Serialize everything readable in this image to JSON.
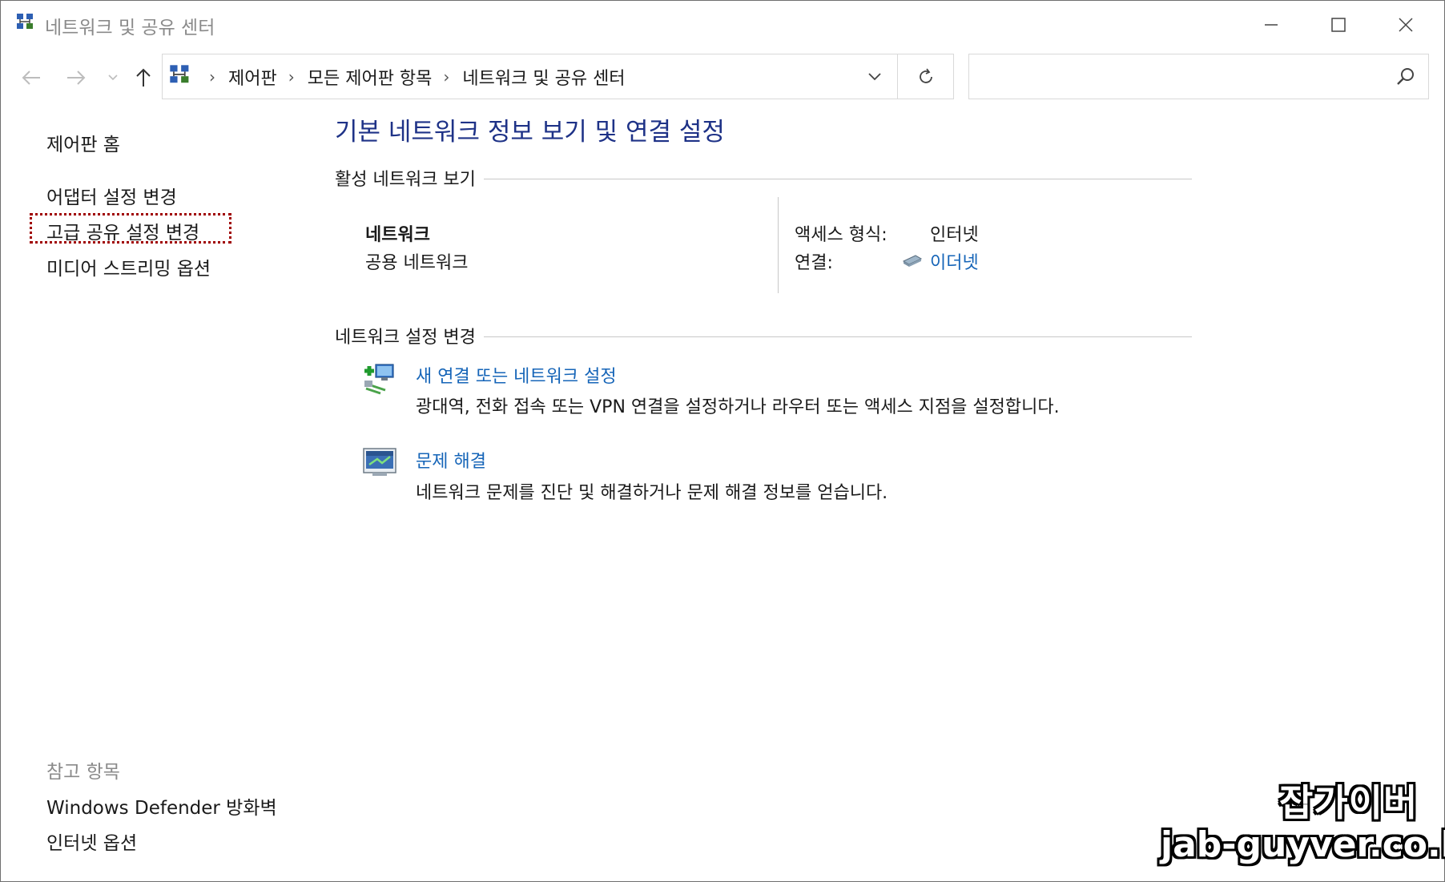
{
  "window": {
    "title": "네트워크 및 공유 센터",
    "buttons": {
      "minimize": "minimize-icon",
      "maximize": "maximize-icon",
      "close": "close-icon"
    }
  },
  "nav": {
    "icons": [
      "back-arrow-icon",
      "forward-arrow-icon",
      "recent-locations-icon",
      "up-arrow-icon"
    ],
    "breadcrumbs": [
      "제어판",
      "모든 제어판 항목",
      "네트워크 및 공유 센터"
    ],
    "search_placeholder": ""
  },
  "left_pane": {
    "items": [
      "제어판 홈",
      "어댑터 설정 변경",
      "고급 공유 설정 변경",
      "미디어 스트리밍 옵션"
    ],
    "see_also_label": "참고 항목",
    "see_also_items": [
      "Windows Defender 방화벽",
      "인터넷 옵션"
    ]
  },
  "main": {
    "title": "기본 네트워크 정보 보기 및 연결 설정",
    "active_networks": {
      "heading": "활성 네트워크 보기",
      "network_name": "네트워크",
      "network_type": "공용 네트워크",
      "access_type_label": "액세스 형식:",
      "access_type_value": "인터넷",
      "connection_label": "연결:",
      "connection_value": "이더넷"
    },
    "change_settings": {
      "heading": "네트워크 설정 변경",
      "tasks": [
        {
          "link": "새 연결 또는 네트워크 설정",
          "description": "광대역, 전화 접속 또는 VPN 연결을 설정하거나 라우터 또는 액세스 지점을 설정합니다."
        },
        {
          "link": "문제 해결",
          "description": "네트워크 문제를 진단 및 해결하거나 문제 해결 정보를 얻습니다."
        }
      ]
    }
  },
  "watermark": {
    "name": "잡가이버",
    "url": "jab-guyver.co.kr"
  },
  "colors": {
    "link": "#1665b8",
    "title": "#1e3287",
    "focus_outline": "#a00000"
  }
}
